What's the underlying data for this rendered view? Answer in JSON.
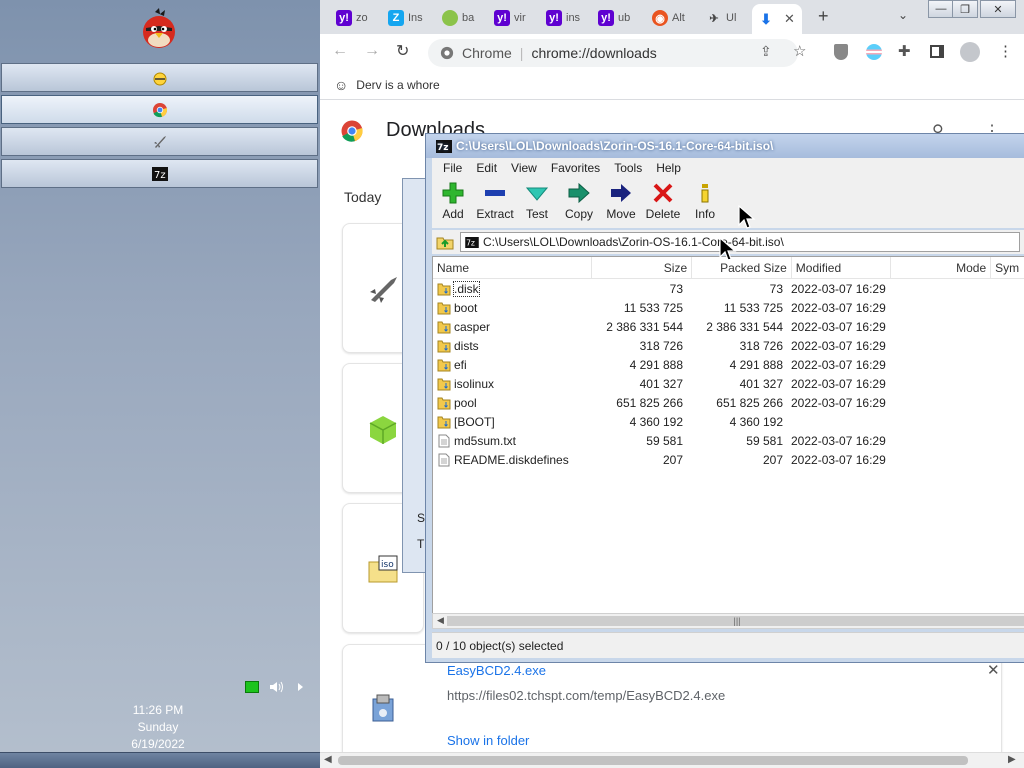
{
  "taskbar": {
    "clock": {
      "time": "11:26 PM",
      "day": "Sunday",
      "date": "6/19/2022"
    }
  },
  "chrome": {
    "tabs": [
      {
        "label": "zo",
        "icon": "yahoo-icon",
        "color": "#5f01d1"
      },
      {
        "label": "Ins",
        "icon": "zorin-icon",
        "color": "#15a6f0"
      },
      {
        "label": "ba",
        "icon": "green-circle-icon",
        "color": "#8bc34a"
      },
      {
        "label": "vir",
        "icon": "yahoo-icon",
        "color": "#5f01d1"
      },
      {
        "label": "ins",
        "icon": "yahoo-icon",
        "color": "#5f01d1"
      },
      {
        "label": "ub",
        "icon": "yahoo-icon",
        "color": "#5f01d1"
      },
      {
        "label": "Alt",
        "icon": "ubuntu-icon",
        "color": "#e95420"
      },
      {
        "label": "Ul",
        "icon": "rocket-icon",
        "color": "#444444"
      },
      {
        "label": "",
        "icon": "download-icon",
        "color": "#1a73e8"
      }
    ],
    "omnibox": {
      "site": "Chrome",
      "url": "chrome://downloads"
    },
    "bookmark": "Derv is a whore",
    "downloads": {
      "title": "Downloads",
      "section": "Today",
      "last_file": {
        "name": "EasyBCD2.4.exe",
        "url": "https://files02.tchspt.com/temp/EasyBCD2.4.exe",
        "action": "Show in folder"
      },
      "card_left_text": {
        "s": "S",
        "t": "T"
      }
    }
  },
  "sevenzip": {
    "title": "C:\\Users\\LOL\\Downloads\\Zorin-OS-16.1-Core-64-bit.iso\\",
    "menu": [
      "File",
      "Edit",
      "View",
      "Favorites",
      "Tools",
      "Help"
    ],
    "tools": [
      "Add",
      "Extract",
      "Test",
      "Copy",
      "Move",
      "Delete",
      "Info"
    ],
    "address": "C:\\Users\\LOL\\Downloads\\Zorin-OS-16.1-Core-64-bit.iso\\",
    "columns": [
      "Name",
      "Size",
      "Packed Size",
      "Modified",
      "Mode",
      "Sym"
    ],
    "rows": [
      {
        "name": ".disk",
        "size": "73",
        "packed": "73",
        "modified": "2022-03-07 16:29",
        "type": "folder"
      },
      {
        "name": "boot",
        "size": "11 533 725",
        "packed": "11 533 725",
        "modified": "2022-03-07 16:29",
        "type": "folder"
      },
      {
        "name": "casper",
        "size": "2 386 331 544",
        "packed": "2 386 331 544",
        "modified": "2022-03-07 16:29",
        "type": "folder"
      },
      {
        "name": "dists",
        "size": "318 726",
        "packed": "318 726",
        "modified": "2022-03-07 16:29",
        "type": "folder"
      },
      {
        "name": "efi",
        "size": "4 291 888",
        "packed": "4 291 888",
        "modified": "2022-03-07 16:29",
        "type": "folder"
      },
      {
        "name": "isolinux",
        "size": "401 327",
        "packed": "401 327",
        "modified": "2022-03-07 16:29",
        "type": "folder"
      },
      {
        "name": "pool",
        "size": "651 825 266",
        "packed": "651 825 266",
        "modified": "2022-03-07 16:29",
        "type": "folder"
      },
      {
        "name": "[BOOT]",
        "size": "4 360 192",
        "packed": "4 360 192",
        "modified": "",
        "type": "folder"
      },
      {
        "name": "md5sum.txt",
        "size": "59 581",
        "packed": "59 581",
        "modified": "2022-03-07 16:29",
        "type": "file"
      },
      {
        "name": "README.diskdefines",
        "size": "207",
        "packed": "207",
        "modified": "2022-03-07 16:29",
        "type": "file"
      }
    ],
    "status": "0 / 10 object(s) selected"
  }
}
